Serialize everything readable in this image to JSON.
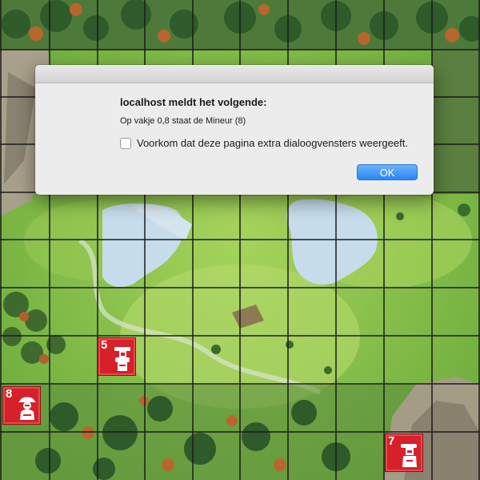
{
  "dialog": {
    "heading": "localhost meldt het volgende:",
    "message": "Op vakje 0,8 staat de Mineur (8)",
    "suppress_label": "Voorkom dat deze pagina extra dialoogvensters weergeeft.",
    "suppress_checked": false,
    "ok_label": "OK"
  },
  "board": {
    "grid_color": "#1b1b1b",
    "pieces": [
      {
        "rank": "5",
        "color": "#d6202a",
        "icon": "sergeant-icon"
      },
      {
        "rank": "8",
        "color": "#d6202a",
        "icon": "miner-icon"
      },
      {
        "rank": "7",
        "color": "#d6202a",
        "icon": "lieutenant-icon"
      }
    ]
  },
  "colors": {
    "grass": "#7fbf4a",
    "water": "#c7dcea",
    "button_accent": "#2a86f4"
  }
}
